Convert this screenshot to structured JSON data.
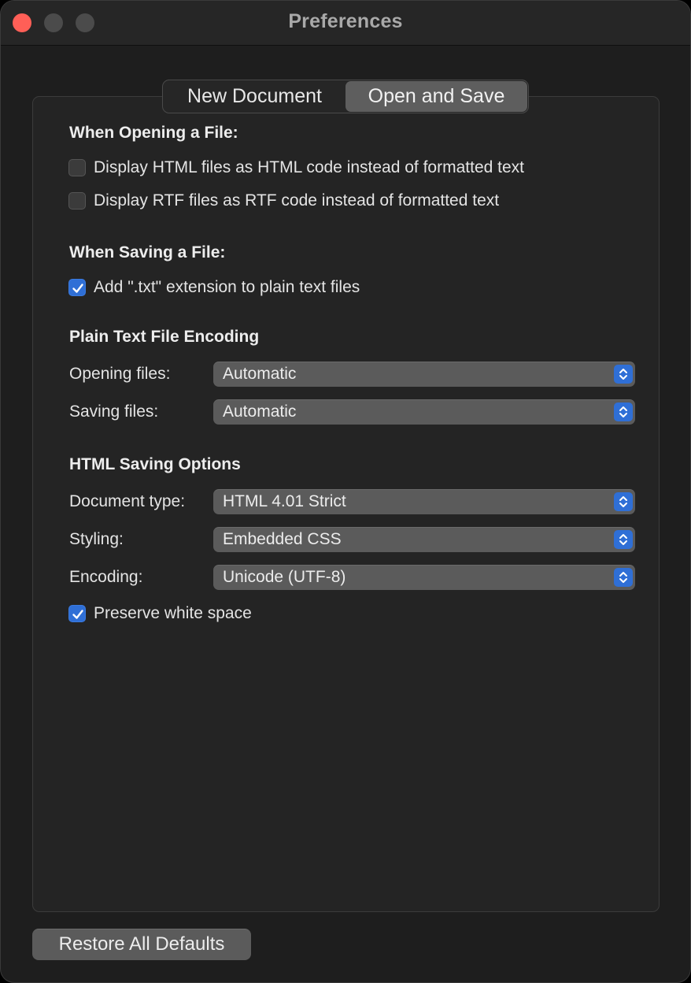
{
  "window": {
    "title": "Preferences"
  },
  "tabs": [
    {
      "label": "New Document",
      "selected": false
    },
    {
      "label": "Open and Save",
      "selected": true
    }
  ],
  "opening": {
    "heading": "When Opening a File:",
    "options": [
      {
        "label": "Display HTML files as HTML code instead of formatted text",
        "checked": false
      },
      {
        "label": "Display RTF files as RTF code instead of formatted text",
        "checked": false
      }
    ]
  },
  "saving": {
    "heading": "When Saving a File:",
    "options": [
      {
        "label": "Add \".txt\" extension to plain text files",
        "checked": true
      }
    ]
  },
  "encoding": {
    "heading": "Plain Text File Encoding",
    "opening_label": "Opening files:",
    "opening_value": "Automatic",
    "saving_label": "Saving files:",
    "saving_value": "Automatic"
  },
  "html_options": {
    "heading": "HTML Saving Options",
    "doctype_label": "Document type:",
    "doctype_value": "HTML 4.01 Strict",
    "styling_label": "Styling:",
    "styling_value": "Embedded CSS",
    "encoding_label": "Encoding:",
    "encoding_value": "Unicode (UTF-8)",
    "preserve_label": "Preserve white space",
    "preserve_checked": true
  },
  "footer": {
    "restore_label": "Restore All Defaults"
  },
  "colors": {
    "accent": "#2f6fd6",
    "close": "#ff5f57",
    "window_bg": "#1e1e1e"
  },
  "icons": {
    "check": "checkmark-icon",
    "stepper": "chevron-up-down-icon"
  }
}
